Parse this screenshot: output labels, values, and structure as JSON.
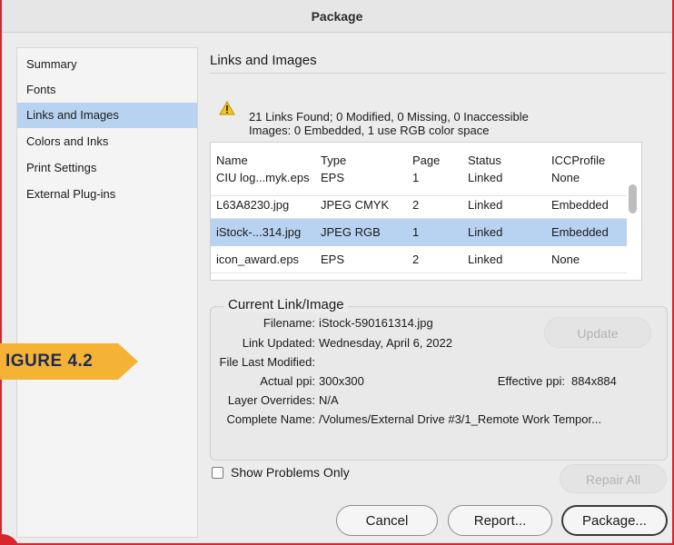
{
  "window": {
    "title": "Package"
  },
  "sidebar": {
    "items": [
      {
        "label": "Summary",
        "selected": false
      },
      {
        "label": "Fonts",
        "selected": false
      },
      {
        "label": "Links and Images",
        "selected": true
      },
      {
        "label": "Colors and Inks",
        "selected": false
      },
      {
        "label": "Print Settings",
        "selected": false
      },
      {
        "label": "External Plug-ins",
        "selected": false
      }
    ]
  },
  "section": {
    "title": "Links and Images",
    "warning_icon": "warning-triangle-icon",
    "summary_line1": "21 Links Found; 0 Modified, 0 Missing, 0 Inaccessible",
    "summary_line2": "Images: 0 Embedded, 1 use RGB color space"
  },
  "links_table": {
    "columns": [
      "Name",
      "Type",
      "Page",
      "Status",
      "ICCProfile"
    ],
    "rows": [
      {
        "name": "CIU log...myk.eps",
        "type": "EPS",
        "page": "1",
        "status": "Linked",
        "icc": "None",
        "selected": false
      },
      {
        "name": "L63A8230.jpg",
        "type": "JPEG CMYK",
        "page": "2",
        "status": "Linked",
        "icc": "Embedded",
        "selected": false
      },
      {
        "name": "iStock-...314.jpg",
        "type": "JPEG RGB",
        "page": "1",
        "status": "Linked",
        "icc": "Embedded",
        "selected": true
      },
      {
        "name": "icon_award.eps",
        "type": "EPS",
        "page": "2",
        "status": "Linked",
        "icc": "None",
        "selected": false
      }
    ]
  },
  "current_link": {
    "title": "Current Link/Image",
    "filename_label": "Filename:",
    "filename": "iStock-590161314.jpg",
    "link_updated_label": "Link Updated:",
    "link_updated": "Wednesday, April 6, 2022",
    "file_last_modified_label": "File Last Modified:",
    "actual_ppi_label": "Actual ppi:",
    "actual_ppi": "300x300",
    "effective_ppi_label": "Effective ppi:",
    "effective_ppi": "884x884",
    "layer_overrides_label": "Layer Overrides:",
    "layer_overrides": "N/A",
    "complete_name_label": "Complete Name:",
    "complete_name": "/Volumes/External Drive #3/1_Remote Work Tempor...",
    "update_button": "Update"
  },
  "options": {
    "show_problems_only": "Show Problems Only",
    "show_problems_checked": false,
    "repair_all_button": "Repair All"
  },
  "footer": {
    "cancel": "Cancel",
    "report": "Report...",
    "package": "Package..."
  },
  "callout": {
    "label": "IGURE 4.2",
    "color": "#f5b335"
  },
  "colors": {
    "selection": "#b8d3f1",
    "frame_border": "#d7262d"
  }
}
